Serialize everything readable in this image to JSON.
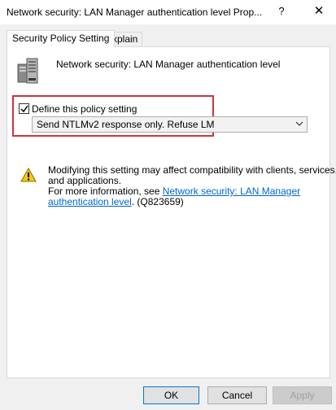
{
  "window": {
    "title": "Network security: LAN Manager authentication level Prop...",
    "help_label": "?",
    "close_label": "✕"
  },
  "tabs": [
    {
      "label": "Security Policy Setting",
      "active": true
    },
    {
      "label": "Explain",
      "active": false
    }
  ],
  "policy": {
    "icon": "server-computer-icon",
    "name": "Network security: LAN Manager authentication level"
  },
  "define_setting": {
    "label": "Define this policy setting",
    "checked": true
  },
  "dropdown": {
    "selected": "Send NTLMv2 response only. Refuse LM"
  },
  "warning": {
    "icon": "warning-icon",
    "line1": "Modifying this setting may affect compatibility with clients, services,",
    "line2": "and applications.",
    "line3_prefix": "For more information, see ",
    "link_part1": "Network security: LAN Manager",
    "link_part2": "authentication level",
    "line4_suffix": ". (Q823659)"
  },
  "buttons": {
    "ok": "OK",
    "cancel": "Cancel",
    "apply": "Apply"
  },
  "colors": {
    "highlight_border": "#d13438",
    "link": "#0066cc",
    "accent": "#0078d7"
  }
}
